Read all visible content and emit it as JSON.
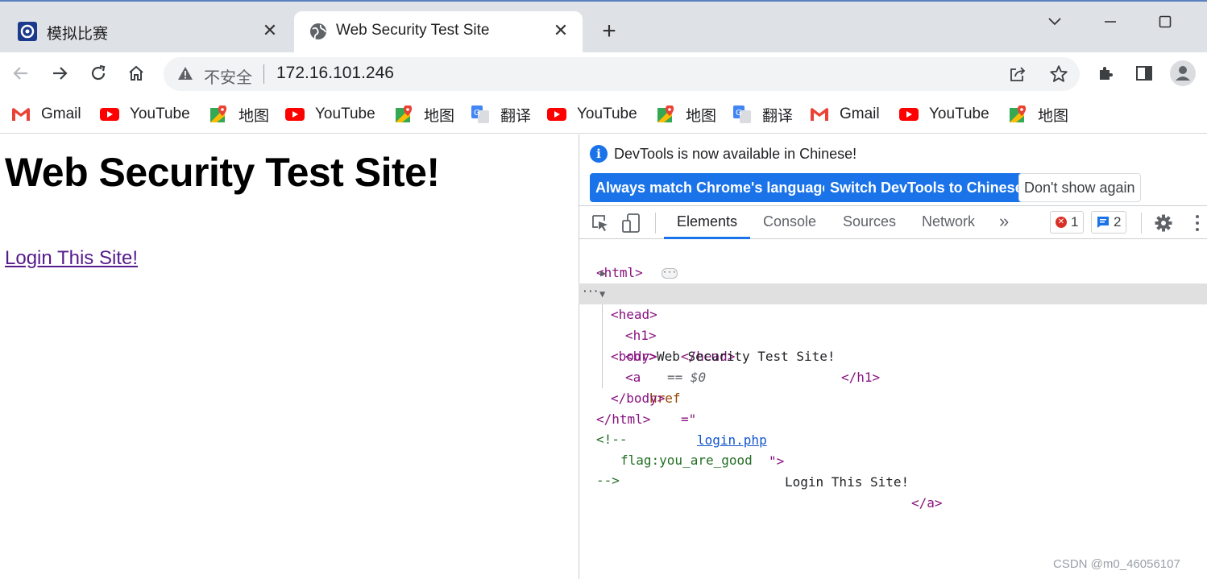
{
  "tabs": [
    {
      "title": "模拟比赛",
      "icon": "ctf-logo-icon"
    },
    {
      "title": "Web Security Test Site",
      "icon": "globe-icon",
      "active": true
    }
  ],
  "address_bar": {
    "security_label": "不安全",
    "url": "172.16.101.246"
  },
  "bookmarks": [
    {
      "label": "Gmail",
      "icon": "gmail-icon"
    },
    {
      "label": "YouTube",
      "icon": "youtube-icon"
    },
    {
      "label": "地图",
      "icon": "maps-icon"
    },
    {
      "label": "YouTube",
      "icon": "youtube-icon"
    },
    {
      "label": "地图",
      "icon": "maps-icon"
    },
    {
      "label": "翻译",
      "icon": "translate-icon"
    },
    {
      "label": "YouTube",
      "icon": "youtube-icon"
    },
    {
      "label": "地图",
      "icon": "maps-icon"
    },
    {
      "label": "翻译",
      "icon": "translate-icon"
    },
    {
      "label": "Gmail",
      "icon": "gmail-icon"
    },
    {
      "label": "YouTube",
      "icon": "youtube-icon"
    },
    {
      "label": "地图",
      "icon": "maps-icon"
    }
  ],
  "page": {
    "heading": "Web Security Test Site!",
    "link_text": "Login This Site!"
  },
  "devtools": {
    "info_message": "DevTools is now available in Chinese!",
    "buttons": {
      "match_language": "Always match Chrome's language",
      "switch_chinese": "Switch DevTools to Chinese",
      "dont_show": "Don't show again"
    },
    "tabs": [
      "Elements",
      "Console",
      "Sources",
      "Network"
    ],
    "more_tabs": "»",
    "error_count": "1",
    "message_count": "2",
    "tree": {
      "html_open": "<html>",
      "head_open": "<head>",
      "head_close": "</head>",
      "body_open": "<body>",
      "selected_marker": "== $0",
      "h1_open": "<h1>",
      "h1_text": "Web Security Test Site!",
      "h1_close": "</h1>",
      "br": "<br>",
      "a_open": "<a ",
      "a_attr": "href",
      "a_eq": "=\"",
      "a_href": "login.php",
      "a_close_quote": "\">",
      "a_text": "Login This Site!",
      "a_close": "</a>",
      "body_close": "</body>",
      "html_close": "</html>",
      "comment_open": "<!--",
      "comment_text": "flag:you_are_good",
      "comment_close": "-->"
    }
  },
  "watermark": "CSDN @m0_46056107",
  "colors": {
    "accent": "#1a73e8",
    "tabstrip": "#dee1e6",
    "tag": "#881280",
    "comment": "#236e25"
  }
}
